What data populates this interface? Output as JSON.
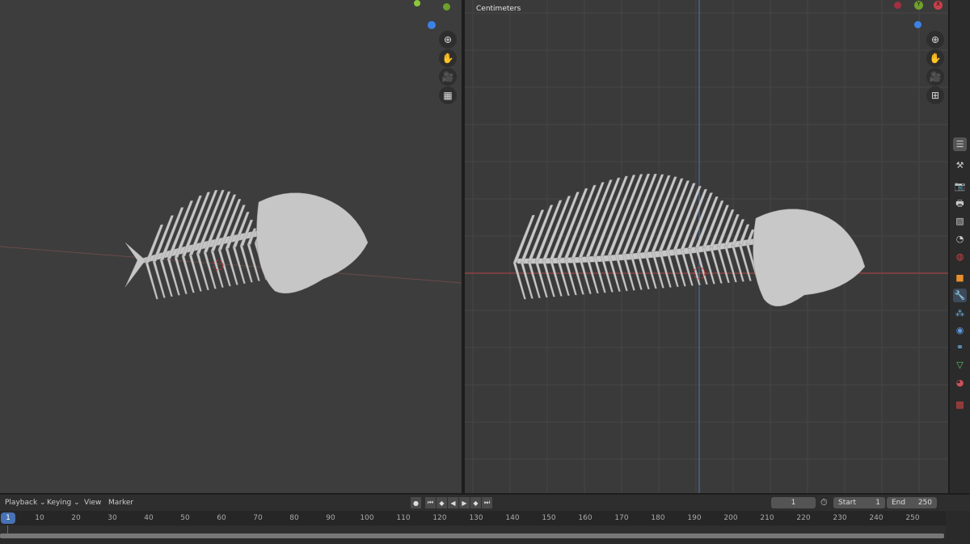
{
  "viewport_right": {
    "units": "Centimeters"
  },
  "timeline": {
    "menus": [
      "Playback",
      "Keying",
      "View",
      "Marker"
    ],
    "current_frame": "1",
    "start_label": "Start",
    "start": "1",
    "end_label": "End",
    "end": "250",
    "ticks": [
      "10",
      "20",
      "30",
      "40",
      "50",
      "60",
      "70",
      "80",
      "90",
      "100",
      "110",
      "120",
      "130",
      "140",
      "150",
      "160",
      "170",
      "180",
      "190",
      "200",
      "210",
      "220",
      "230",
      "240",
      "250"
    ],
    "playhead": "1"
  },
  "colors": {
    "accent": "#4772b3",
    "x_axis": "#c8404a",
    "y_axis": "#6ea02c",
    "z_axis": "#3c82e6",
    "bone": "#c8c8c8"
  }
}
